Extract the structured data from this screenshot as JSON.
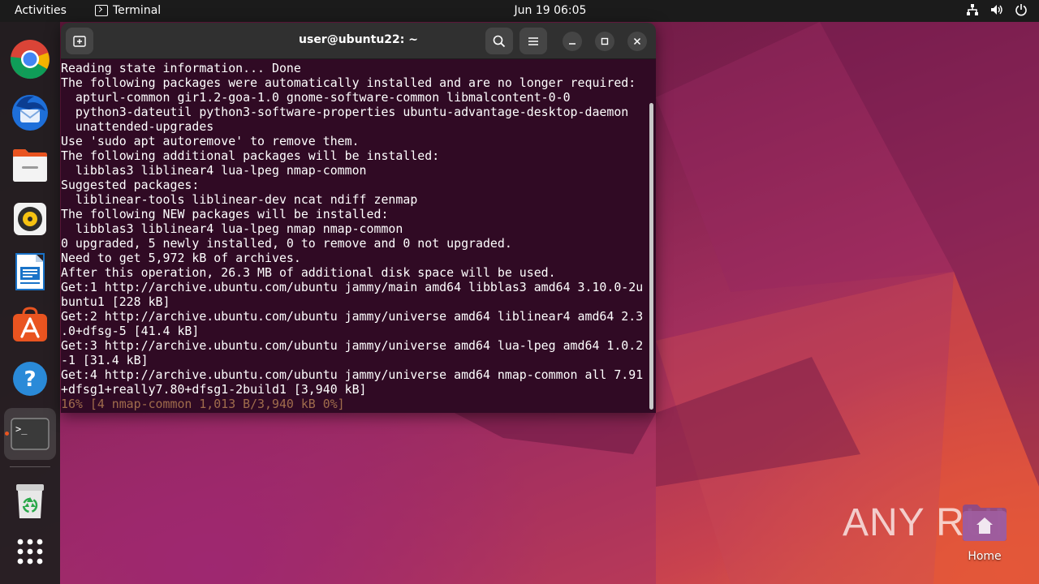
{
  "topbar": {
    "activities": "Activities",
    "app_name": "Terminal",
    "clock": "Jun 19  06:05",
    "status_icons": [
      "network-icon",
      "volume-icon",
      "power-icon"
    ]
  },
  "dock": {
    "items": [
      {
        "name": "Google Chrome",
        "icon": "chrome-icon"
      },
      {
        "name": "Thunderbird Mail",
        "icon": "thunderbird-icon"
      },
      {
        "name": "Files",
        "icon": "files-icon"
      },
      {
        "name": "Rhythmbox",
        "icon": "rhythmbox-icon"
      },
      {
        "name": "LibreOffice Writer",
        "icon": "writer-icon"
      },
      {
        "name": "Ubuntu Software",
        "icon": "software-icon"
      },
      {
        "name": "Help",
        "icon": "help-icon"
      },
      {
        "name": "Terminal",
        "icon": "terminal-icon",
        "active": true
      },
      {
        "name": "Trash",
        "icon": "trash-icon"
      },
      {
        "name": "Show Applications",
        "icon": "apps-grid-icon"
      }
    ],
    "terminal_glyph": ">_"
  },
  "terminal": {
    "title": "user@ubuntu22: ~",
    "lines": [
      "Reading state information... Done",
      "The following packages were automatically installed and are no longer required:",
      "  apturl-common gir1.2-goa-1.0 gnome-software-common libmalcontent-0-0",
      "  python3-dateutil python3-software-properties ubuntu-advantage-desktop-daemon",
      "  unattended-upgrades",
      "Use 'sudo apt autoremove' to remove them.",
      "The following additional packages will be installed:",
      "  libblas3 liblinear4 lua-lpeg nmap-common",
      "Suggested packages:",
      "  liblinear-tools liblinear-dev ncat ndiff zenmap",
      "The following NEW packages will be installed:",
      "  libblas3 liblinear4 lua-lpeg nmap nmap-common",
      "0 upgraded, 5 newly installed, 0 to remove and 0 not upgraded.",
      "Need to get 5,972 kB of archives.",
      "After this operation, 26.3 MB of additional disk space will be used.",
      "Get:1 http://archive.ubuntu.com/ubuntu jammy/main amd64 libblas3 amd64 3.10.0-2u",
      "buntu1 [228 kB]",
      "Get:2 http://archive.ubuntu.com/ubuntu jammy/universe amd64 liblinear4 amd64 2.3",
      ".0+dfsg-5 [41.4 kB]",
      "Get:3 http://archive.ubuntu.com/ubuntu jammy/universe amd64 lua-lpeg amd64 1.0.2",
      "-1 [31.4 kB]",
      "Get:4 http://archive.ubuntu.com/ubuntu jammy/universe amd64 nmap-common all 7.91",
      "+dfsg1+really7.80+dfsg1-2build1 [3,940 kB]"
    ],
    "progress_line": "16% [4 nmap-common 1,013 B/3,940 kB 0%]"
  },
  "desktop": {
    "home_label": "Home",
    "watermark": "ANY RUN"
  },
  "colors": {
    "terminal_bg": "#300a24",
    "topbar_bg": "#1b1b1b",
    "accent": "#e95420",
    "progress_text": "#a06c4c"
  }
}
